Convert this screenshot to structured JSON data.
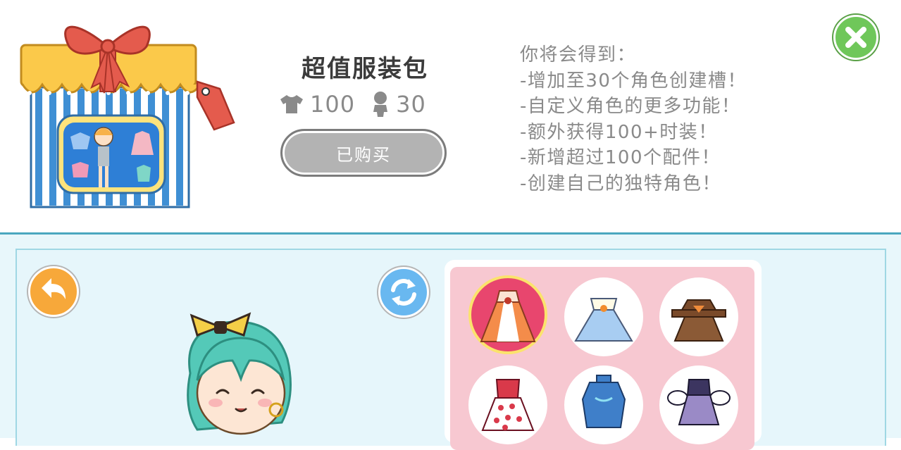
{
  "promo": {
    "title": "超值服装包",
    "clothes_count": "100",
    "characters_count": "30",
    "purchase_button": "已购买",
    "benefits": [
      "你将会得到：",
      "-增加至30个角色创建槽！",
      "-自定义角色的更多功能！",
      "-额外获得100+时装！",
      "-新增超过100个配件！",
      "-创建自己的独特角色！"
    ]
  },
  "colors": {
    "close_button": "#6fc75a",
    "back_button": "#f7a83a",
    "refresh_button": "#69b8f0",
    "selected_slot": "#e8466e",
    "wardrobe_bg": "#f7c8d1",
    "editor_bg": "#e8f7fb"
  },
  "icons": {
    "close": "close-icon",
    "back": "back-arrow-icon",
    "refresh": "refresh-icon",
    "clothes": "tshirt-icon",
    "characters": "person-icon"
  },
  "wardrobe": {
    "items": [
      {
        "name": "orange-gown",
        "selected": true
      },
      {
        "name": "blue-ball-dress",
        "selected": false
      },
      {
        "name": "brown-lolita-dress",
        "selected": false
      },
      {
        "name": "red-polka-dot-dress",
        "selected": false
      },
      {
        "name": "blue-qipao-dress",
        "selected": false
      },
      {
        "name": "purple-puff-dress",
        "selected": false
      }
    ]
  }
}
